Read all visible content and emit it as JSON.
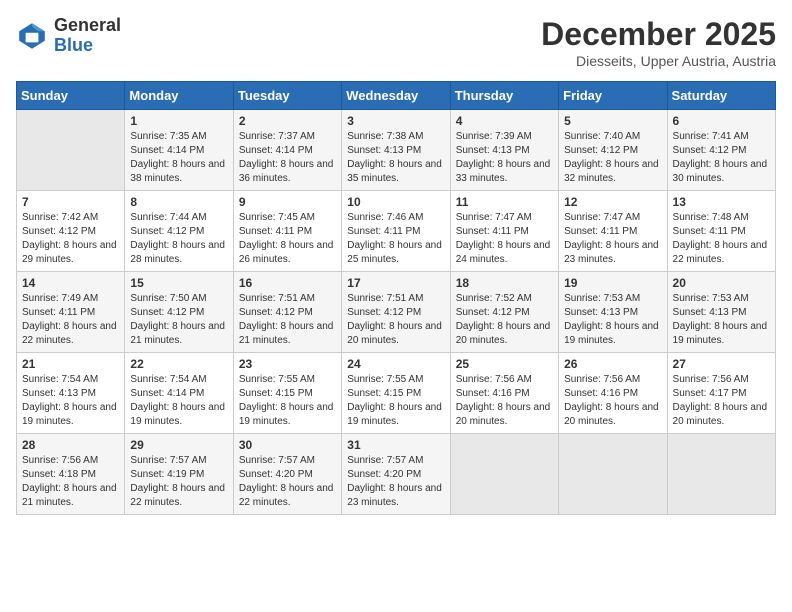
{
  "header": {
    "logo_line1": "General",
    "logo_line2": "Blue",
    "month": "December 2025",
    "location": "Diesseits, Upper Austria, Austria"
  },
  "days_of_week": [
    "Sunday",
    "Monday",
    "Tuesday",
    "Wednesday",
    "Thursday",
    "Friday",
    "Saturday"
  ],
  "weeks": [
    [
      {
        "day": "",
        "empty": true
      },
      {
        "day": "1",
        "sunrise": "Sunrise: 7:35 AM",
        "sunset": "Sunset: 4:14 PM",
        "daylight": "Daylight: 8 hours and 38 minutes."
      },
      {
        "day": "2",
        "sunrise": "Sunrise: 7:37 AM",
        "sunset": "Sunset: 4:14 PM",
        "daylight": "Daylight: 8 hours and 36 minutes."
      },
      {
        "day": "3",
        "sunrise": "Sunrise: 7:38 AM",
        "sunset": "Sunset: 4:13 PM",
        "daylight": "Daylight: 8 hours and 35 minutes."
      },
      {
        "day": "4",
        "sunrise": "Sunrise: 7:39 AM",
        "sunset": "Sunset: 4:13 PM",
        "daylight": "Daylight: 8 hours and 33 minutes."
      },
      {
        "day": "5",
        "sunrise": "Sunrise: 7:40 AM",
        "sunset": "Sunset: 4:12 PM",
        "daylight": "Daylight: 8 hours and 32 minutes."
      },
      {
        "day": "6",
        "sunrise": "Sunrise: 7:41 AM",
        "sunset": "Sunset: 4:12 PM",
        "daylight": "Daylight: 8 hours and 30 minutes."
      }
    ],
    [
      {
        "day": "7",
        "sunrise": "Sunrise: 7:42 AM",
        "sunset": "Sunset: 4:12 PM",
        "daylight": "Daylight: 8 hours and 29 minutes."
      },
      {
        "day": "8",
        "sunrise": "Sunrise: 7:44 AM",
        "sunset": "Sunset: 4:12 PM",
        "daylight": "Daylight: 8 hours and 28 minutes."
      },
      {
        "day": "9",
        "sunrise": "Sunrise: 7:45 AM",
        "sunset": "Sunset: 4:11 PM",
        "daylight": "Daylight: 8 hours and 26 minutes."
      },
      {
        "day": "10",
        "sunrise": "Sunrise: 7:46 AM",
        "sunset": "Sunset: 4:11 PM",
        "daylight": "Daylight: 8 hours and 25 minutes."
      },
      {
        "day": "11",
        "sunrise": "Sunrise: 7:47 AM",
        "sunset": "Sunset: 4:11 PM",
        "daylight": "Daylight: 8 hours and 24 minutes."
      },
      {
        "day": "12",
        "sunrise": "Sunrise: 7:47 AM",
        "sunset": "Sunset: 4:11 PM",
        "daylight": "Daylight: 8 hours and 23 minutes."
      },
      {
        "day": "13",
        "sunrise": "Sunrise: 7:48 AM",
        "sunset": "Sunset: 4:11 PM",
        "daylight": "Daylight: 8 hours and 22 minutes."
      }
    ],
    [
      {
        "day": "14",
        "sunrise": "Sunrise: 7:49 AM",
        "sunset": "Sunset: 4:11 PM",
        "daylight": "Daylight: 8 hours and 22 minutes."
      },
      {
        "day": "15",
        "sunrise": "Sunrise: 7:50 AM",
        "sunset": "Sunset: 4:12 PM",
        "daylight": "Daylight: 8 hours and 21 minutes."
      },
      {
        "day": "16",
        "sunrise": "Sunrise: 7:51 AM",
        "sunset": "Sunset: 4:12 PM",
        "daylight": "Daylight: 8 hours and 21 minutes."
      },
      {
        "day": "17",
        "sunrise": "Sunrise: 7:51 AM",
        "sunset": "Sunset: 4:12 PM",
        "daylight": "Daylight: 8 hours and 20 minutes."
      },
      {
        "day": "18",
        "sunrise": "Sunrise: 7:52 AM",
        "sunset": "Sunset: 4:12 PM",
        "daylight": "Daylight: 8 hours and 20 minutes."
      },
      {
        "day": "19",
        "sunrise": "Sunrise: 7:53 AM",
        "sunset": "Sunset: 4:13 PM",
        "daylight": "Daylight: 8 hours and 19 minutes."
      },
      {
        "day": "20",
        "sunrise": "Sunrise: 7:53 AM",
        "sunset": "Sunset: 4:13 PM",
        "daylight": "Daylight: 8 hours and 19 minutes."
      }
    ],
    [
      {
        "day": "21",
        "sunrise": "Sunrise: 7:54 AM",
        "sunset": "Sunset: 4:13 PM",
        "daylight": "Daylight: 8 hours and 19 minutes."
      },
      {
        "day": "22",
        "sunrise": "Sunrise: 7:54 AM",
        "sunset": "Sunset: 4:14 PM",
        "daylight": "Daylight: 8 hours and 19 minutes."
      },
      {
        "day": "23",
        "sunrise": "Sunrise: 7:55 AM",
        "sunset": "Sunset: 4:15 PM",
        "daylight": "Daylight: 8 hours and 19 minutes."
      },
      {
        "day": "24",
        "sunrise": "Sunrise: 7:55 AM",
        "sunset": "Sunset: 4:15 PM",
        "daylight": "Daylight: 8 hours and 19 minutes."
      },
      {
        "day": "25",
        "sunrise": "Sunrise: 7:56 AM",
        "sunset": "Sunset: 4:16 PM",
        "daylight": "Daylight: 8 hours and 20 minutes."
      },
      {
        "day": "26",
        "sunrise": "Sunrise: 7:56 AM",
        "sunset": "Sunset: 4:16 PM",
        "daylight": "Daylight: 8 hours and 20 minutes."
      },
      {
        "day": "27",
        "sunrise": "Sunrise: 7:56 AM",
        "sunset": "Sunset: 4:17 PM",
        "daylight": "Daylight: 8 hours and 20 minutes."
      }
    ],
    [
      {
        "day": "28",
        "sunrise": "Sunrise: 7:56 AM",
        "sunset": "Sunset: 4:18 PM",
        "daylight": "Daylight: 8 hours and 21 minutes."
      },
      {
        "day": "29",
        "sunrise": "Sunrise: 7:57 AM",
        "sunset": "Sunset: 4:19 PM",
        "daylight": "Daylight: 8 hours and 22 minutes."
      },
      {
        "day": "30",
        "sunrise": "Sunrise: 7:57 AM",
        "sunset": "Sunset: 4:20 PM",
        "daylight": "Daylight: 8 hours and 22 minutes."
      },
      {
        "day": "31",
        "sunrise": "Sunrise: 7:57 AM",
        "sunset": "Sunset: 4:20 PM",
        "daylight": "Daylight: 8 hours and 23 minutes."
      },
      {
        "day": "",
        "empty": true
      },
      {
        "day": "",
        "empty": true
      },
      {
        "day": "",
        "empty": true
      }
    ]
  ]
}
